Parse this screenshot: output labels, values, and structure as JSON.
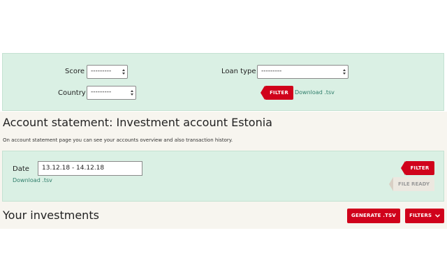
{
  "filters": {
    "score_label": "Score",
    "score_value": "---------",
    "country_label": "Country",
    "country_value": "---------",
    "loan_type_label": "Loan type",
    "loan_type_value": "---------",
    "filter_button": "FILTER",
    "download_link": "Download .tsv"
  },
  "statement": {
    "title": "Account statement: Investment account Estonia",
    "description": "On account statement page you can see your accounts overview and also transaction history.",
    "date_label": "Date",
    "date_value": "13.12.18 - 14.12.18",
    "download_link": "Download .tsv",
    "filter_button": "FILTER",
    "file_ready_button": "FILE READY"
  },
  "investments": {
    "heading": "Your investments",
    "generate_button": "GENERATE .TSV",
    "filters_button": "FILTERS"
  },
  "colors": {
    "accent_red": "#d0021b",
    "panel_green": "#daf0e4",
    "section_beige": "#f7f5ef",
    "link_green": "#2e7d6a"
  }
}
